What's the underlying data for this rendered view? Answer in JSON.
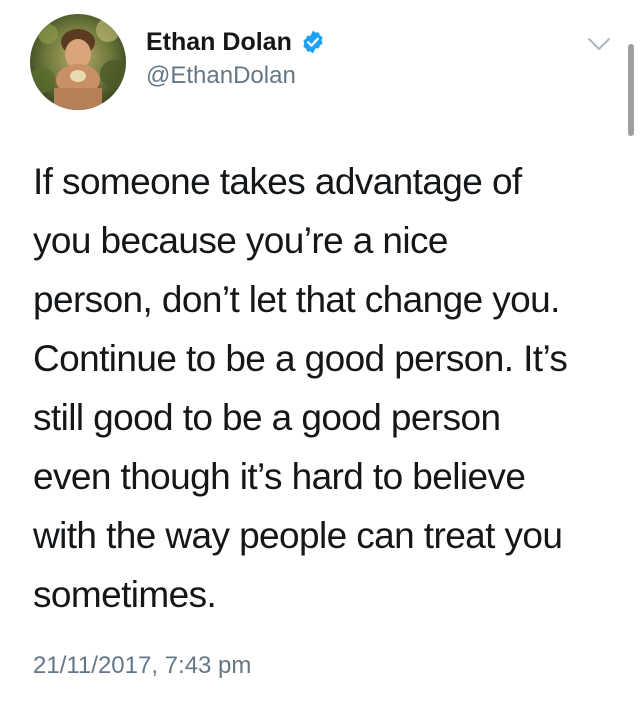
{
  "author": {
    "display_name": "Ethan Dolan",
    "handle": "@EthanDolan",
    "verified": true
  },
  "icons": {
    "avatar": "profile-photo",
    "verified": "verified-badge-icon",
    "more": "chevron-down-icon"
  },
  "tweet": {
    "text": "If someone takes advantage of\nyou because you’re a nice\nperson, don’t let that change you.\nContinue to be a good person. It’s\nstill good to be a good person\neven though it’s hard to believe\nwith the way people can treat you\nsometimes.",
    "timestamp": "21/11/2017, 7:43 pm"
  },
  "colors": {
    "verified_blue": "#1da1f2",
    "secondary_text": "#657786",
    "primary_text": "#14171a",
    "chevron": "#aab8c2"
  }
}
